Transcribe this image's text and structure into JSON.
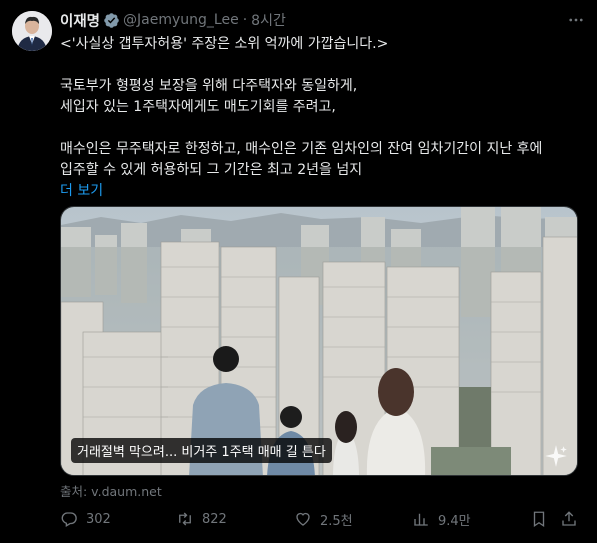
{
  "author": {
    "name": "이재명",
    "handle": "@Jaemyung_Lee",
    "separator": "·",
    "time": "8시간"
  },
  "body": {
    "line1": "<'사실상 갭투자허용' 주장은 소위 억까에 가깝습니다.>",
    "line2": "국토부가 형평성 보장을 위해 다주택자와 동일하게,",
    "line3": "세입자 있는 1주택자에게도 매도기회를 주려고,",
    "line4": "매수인은 무주택자로 한정하고, 매수인은 기존 임차인의 잔여 임차기간이 지난 후에",
    "line5": "입주할 수 있게 허용하되 그 기간은 최고 2년을 넘지",
    "show_more": "더 보기"
  },
  "media": {
    "caption": "거래절벽 막으려... 비거주 1주택 매매 길 튼다"
  },
  "source": "출처: v.daum.net",
  "actions": {
    "replies": "302",
    "reposts": "822",
    "likes": "2.5천",
    "views": "9.4만"
  },
  "icons": [
    "verified-badge-icon",
    "more-icon",
    "reply-icon",
    "repost-icon",
    "like-icon",
    "views-icon",
    "bookmark-icon",
    "share-icon",
    "sparkle-icon"
  ],
  "colors": {
    "background": "#000000",
    "text": "#e7e9ea",
    "muted": "#71767b",
    "link": "#1d9bf0"
  }
}
